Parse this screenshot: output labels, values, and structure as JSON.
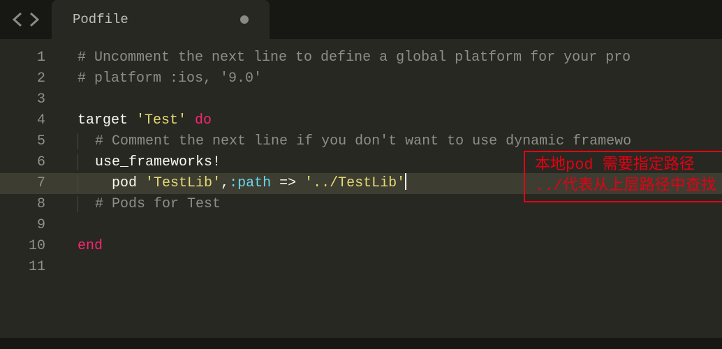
{
  "tab": {
    "title": "Podfile"
  },
  "lineNumbers": [
    "1",
    "2",
    "3",
    "4",
    "5",
    "6",
    "7",
    "8",
    "9",
    "10",
    "11"
  ],
  "activeLine": 7,
  "code": {
    "l1_comment": "# Uncomment the next line to define a global platform for your pro",
    "l2_comment": "# platform :ios, '9.0'",
    "l4_target": "target ",
    "l4_str": "'Test'",
    "l4_do": " do",
    "l5_comment": "# Comment the next line if you don't want to use dynamic framewo",
    "l6_use": "use_frameworks!",
    "l7_pod": "pod ",
    "l7_str1": "'TestLib'",
    "l7_comma": ",",
    "l7_path": ":path",
    "l7_arrow": " => ",
    "l7_str2": "'../TestLib'",
    "l8_comment": "# Pods for Test",
    "l10_end": "end"
  },
  "annotation": {
    "line1": "本地pod 需要指定路径",
    "line2": "../代表从上层路径中查找"
  }
}
